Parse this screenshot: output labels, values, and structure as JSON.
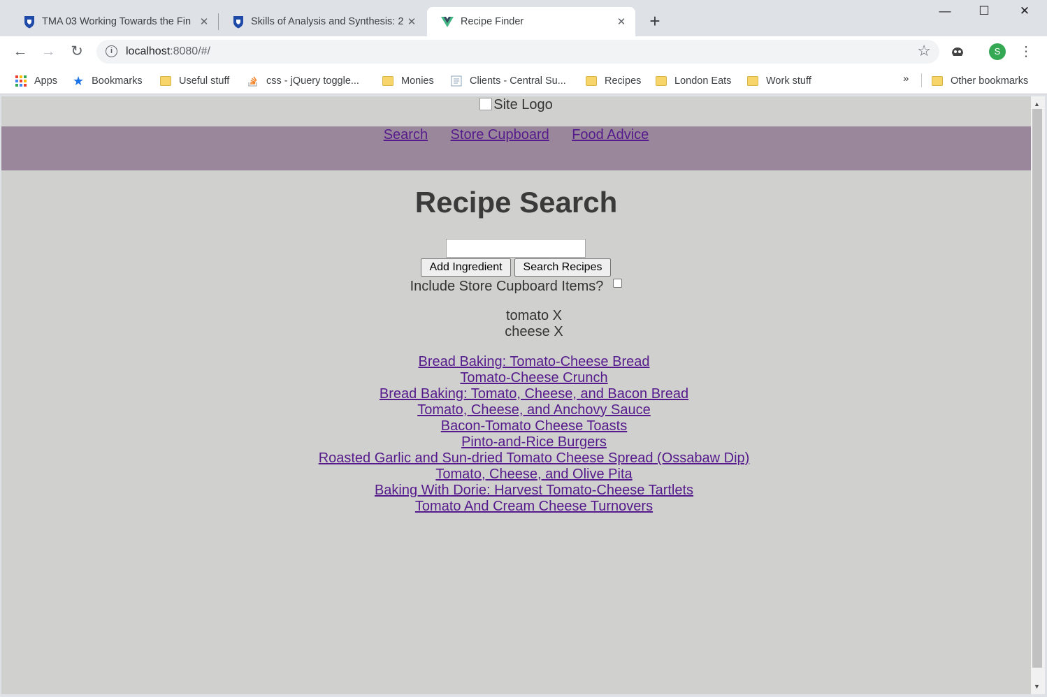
{
  "browser": {
    "tabs": [
      {
        "title": "TMA 03 Working Towards the Fin",
        "icon": "shield-icon"
      },
      {
        "title": "Skills of Analysis and Synthesis: 2",
        "icon": "shield-icon"
      },
      {
        "title": "Recipe Finder",
        "icon": "vue-icon"
      }
    ],
    "new_tab": "+",
    "window_controls": {
      "minimize": "—",
      "maximize": "☐",
      "close": "✕"
    },
    "url_host": "localhost",
    "url_rest": ":8080/#/",
    "profile_initial": "S",
    "bookmarks": [
      {
        "label": "Apps",
        "icon": "apps-icon"
      },
      {
        "label": "Bookmarks",
        "icon": "star-icon"
      },
      {
        "label": "Useful stuff",
        "icon": "folder-icon"
      },
      {
        "label": "css - jQuery toggle...",
        "icon": "stackoverflow-icon"
      },
      {
        "label": "Monies",
        "icon": "folder-icon"
      },
      {
        "label": "Clients - Central Su...",
        "icon": "document-icon"
      },
      {
        "label": "Recipes",
        "icon": "folder-icon"
      },
      {
        "label": "London Eats",
        "icon": "folder-icon"
      },
      {
        "label": "Work stuff",
        "icon": "folder-icon"
      }
    ],
    "more_bookmarks": "»",
    "other_bookmarks": "Other bookmarks"
  },
  "site": {
    "logo_alt": "Site Logo",
    "nav": [
      "Search",
      "Store Cupboard",
      "Food Advice"
    ],
    "nav_color": "#9b879c",
    "background": "#d0d0ce",
    "link_color": "#551a8b"
  },
  "search": {
    "title": "Recipe Search",
    "input_value": "",
    "add_button": "Add Ingredient",
    "search_button": "Search Recipes",
    "cupboard_label": "Include Store Cupboard Items?",
    "cupboard_checked": false,
    "ingredients": [
      "tomato X",
      "cheese X"
    ]
  },
  "results": [
    "Bread Baking: Tomato-Cheese Bread",
    "Tomato-Cheese Crunch",
    "Bread Baking: Tomato, Cheese, and Bacon Bread",
    "Tomato, Cheese, and Anchovy Sauce",
    "Bacon-Tomato Cheese Toasts",
    "Pinto-and-Rice Burgers",
    "Roasted Garlic and Sun-dried Tomato Cheese Spread (Ossabaw Dip)",
    "Tomato, Cheese, and Olive Pita",
    "Baking With Dorie: Harvest Tomato-Cheese Tartlets",
    "Tomato And Cream Cheese Turnovers"
  ]
}
